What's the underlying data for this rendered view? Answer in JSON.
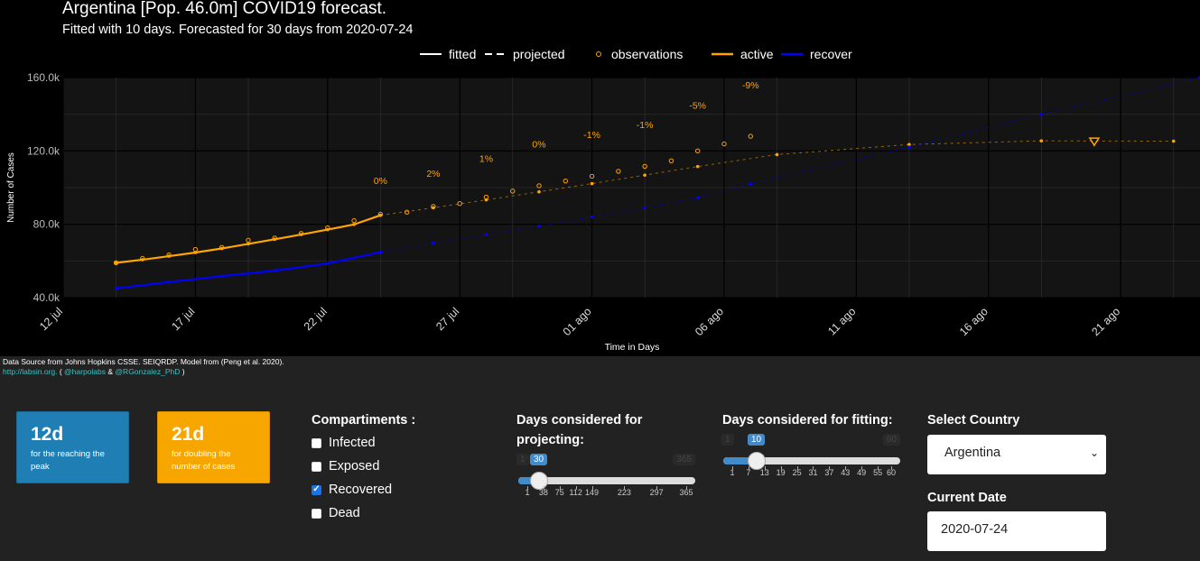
{
  "chart_data": {
    "type": "line",
    "title": "Argentina [Pop. 46.0m] COVID19 forecast.",
    "subtitle": "Fitted with 10 days. Forecasted for 30 days from 2020-07-24",
    "xlabel": "Time in Days",
    "ylabel": "Number of Cases",
    "ylim": [
      40000,
      160000
    ],
    "xlim": [
      "2020-07-12",
      "2020-08-24"
    ],
    "y_ticks": [
      "40.0k",
      "80.0k",
      "120.0k",
      "160.0k"
    ],
    "x_ticks": [
      "12 jul",
      "17 jul",
      "22 jul",
      "27 jul",
      "01 ago",
      "06 ago",
      "11 ago",
      "16 ago",
      "21 ago"
    ],
    "legend": {
      "placement": "top",
      "entries": [
        "fitted",
        "projected",
        "observations",
        "active",
        "recover"
      ]
    },
    "colors": {
      "active": "#ffa500",
      "recover": "#0000ff",
      "fitted": "#ffffff",
      "background": "#000000",
      "panel": "#141414"
    },
    "series": [
      {
        "name": "active",
        "style": "fitted",
        "x": [
          "2020-07-14",
          "2020-07-15",
          "2020-07-16",
          "2020-07-17",
          "2020-07-18",
          "2020-07-19",
          "2020-07-20",
          "2020-07-21",
          "2020-07-22",
          "2020-07-23",
          "2020-07-24"
        ],
        "values": [
          59000,
          60700,
          62600,
          64600,
          66800,
          69300,
          71800,
          74400,
          77100,
          79900,
          84900
        ]
      },
      {
        "name": "active",
        "style": "projected",
        "x": [
          "2020-07-24",
          "2020-07-26",
          "2020-07-28",
          "2020-07-30",
          "2020-08-01",
          "2020-08-03",
          "2020-08-05",
          "2020-08-08",
          "2020-08-13",
          "2020-08-18",
          "2020-08-23"
        ],
        "values": [
          84900,
          89000,
          93300,
          97700,
          102200,
          106800,
          111500,
          118000,
          123500,
          125500,
          125300
        ]
      },
      {
        "name": "active",
        "style": "observations",
        "x": [
          "2020-07-14",
          "2020-07-15",
          "2020-07-16",
          "2020-07-17",
          "2020-07-18",
          "2020-07-19",
          "2020-07-20",
          "2020-07-21",
          "2020-07-22",
          "2020-07-23",
          "2020-07-24",
          "2020-07-25",
          "2020-07-26",
          "2020-07-27",
          "2020-07-28",
          "2020-07-29",
          "2020-07-30",
          "2020-07-31",
          "2020-08-01",
          "2020-08-02",
          "2020-08-03",
          "2020-08-04",
          "2020-08-05",
          "2020-08-06",
          "2020-08-07"
        ],
        "values": [
          59000,
          61400,
          63300,
          66300,
          67400,
          71300,
          72500,
          75000,
          78100,
          82000,
          85500,
          86600,
          89700,
          91300,
          94800,
          98100,
          101000,
          103600,
          106200,
          108900,
          111600,
          114600,
          120000,
          123800,
          128000
        ]
      },
      {
        "name": "recover",
        "style": "fitted",
        "x": [
          "2020-07-14",
          "2020-07-16",
          "2020-07-18",
          "2020-07-20",
          "2020-07-22",
          "2020-07-24"
        ],
        "values": [
          45000,
          48500,
          51700,
          54700,
          58600,
          64800
        ]
      },
      {
        "name": "recover",
        "style": "projected",
        "x": [
          "2020-07-24",
          "2020-07-26",
          "2020-07-28",
          "2020-07-30",
          "2020-08-01",
          "2020-08-03",
          "2020-08-05",
          "2020-08-07",
          "2020-08-13",
          "2020-08-18",
          "2020-08-24"
        ],
        "values": [
          64800,
          69700,
          74300,
          79000,
          84000,
          89000,
          94500,
          102000,
          122000,
          140000,
          160000
        ]
      }
    ],
    "annotations": [
      {
        "x": "2020-07-24",
        "y": 102000,
        "text": "0%"
      },
      {
        "x": "2020-07-26",
        "y": 106000,
        "text": "2%"
      },
      {
        "x": "2020-07-28",
        "y": 114000,
        "text": "1%"
      },
      {
        "x": "2020-07-30",
        "y": 122000,
        "text": "0%"
      },
      {
        "x": "2020-08-01",
        "y": 127000,
        "text": "-1%"
      },
      {
        "x": "2020-08-03",
        "y": 132500,
        "text": "-1%"
      },
      {
        "x": "2020-08-05",
        "y": 143000,
        "text": "-5%"
      },
      {
        "x": "2020-08-07",
        "y": 154000,
        "text": "-9%"
      }
    ],
    "peak_marker": {
      "x": "2020-08-20",
      "y": 125500
    }
  },
  "source": {
    "line1": "Data Source from Johns Hopkins CSSE. SEIQRDP. Model from (Peng et al. 2020).",
    "link1": "http://labsin.org.",
    "sep1": " ( ",
    "link2": "@harpolabs",
    "sep2": " & ",
    "link3": "@RGonzalez_PhD",
    "sep3": " )"
  },
  "boxes": {
    "peak": {
      "value": "12d",
      "label": "for the reaching the peak",
      "color": "#1f7fb5"
    },
    "double": {
      "value": "21d",
      "label": "for doubling the number of cases",
      "color": "#f7a600"
    }
  },
  "compartments": {
    "title": "Compartiments :",
    "items": [
      {
        "label": "Infected",
        "checked": false
      },
      {
        "label": "Exposed",
        "checked": false
      },
      {
        "label": "Recovered",
        "checked": true
      },
      {
        "label": "Dead",
        "checked": false
      }
    ]
  },
  "projecting": {
    "title": "Days considered for projecting:",
    "min": "1",
    "max": "365",
    "value": "30",
    "ticks": [
      "1",
      "38",
      "75",
      "112",
      "149",
      "223",
      "297",
      "365"
    ]
  },
  "fitting": {
    "title": "Days considered for fitting:",
    "min": "1",
    "max": "60",
    "value": "10",
    "ticks": [
      "1",
      "7",
      "13",
      "19",
      "25",
      "31",
      "37",
      "43",
      "49",
      "55",
      "60"
    ]
  },
  "country": {
    "title": "Select Country",
    "selected": "Argentina"
  },
  "current_date": {
    "title": "Current Date",
    "value": "2020-07-24"
  }
}
